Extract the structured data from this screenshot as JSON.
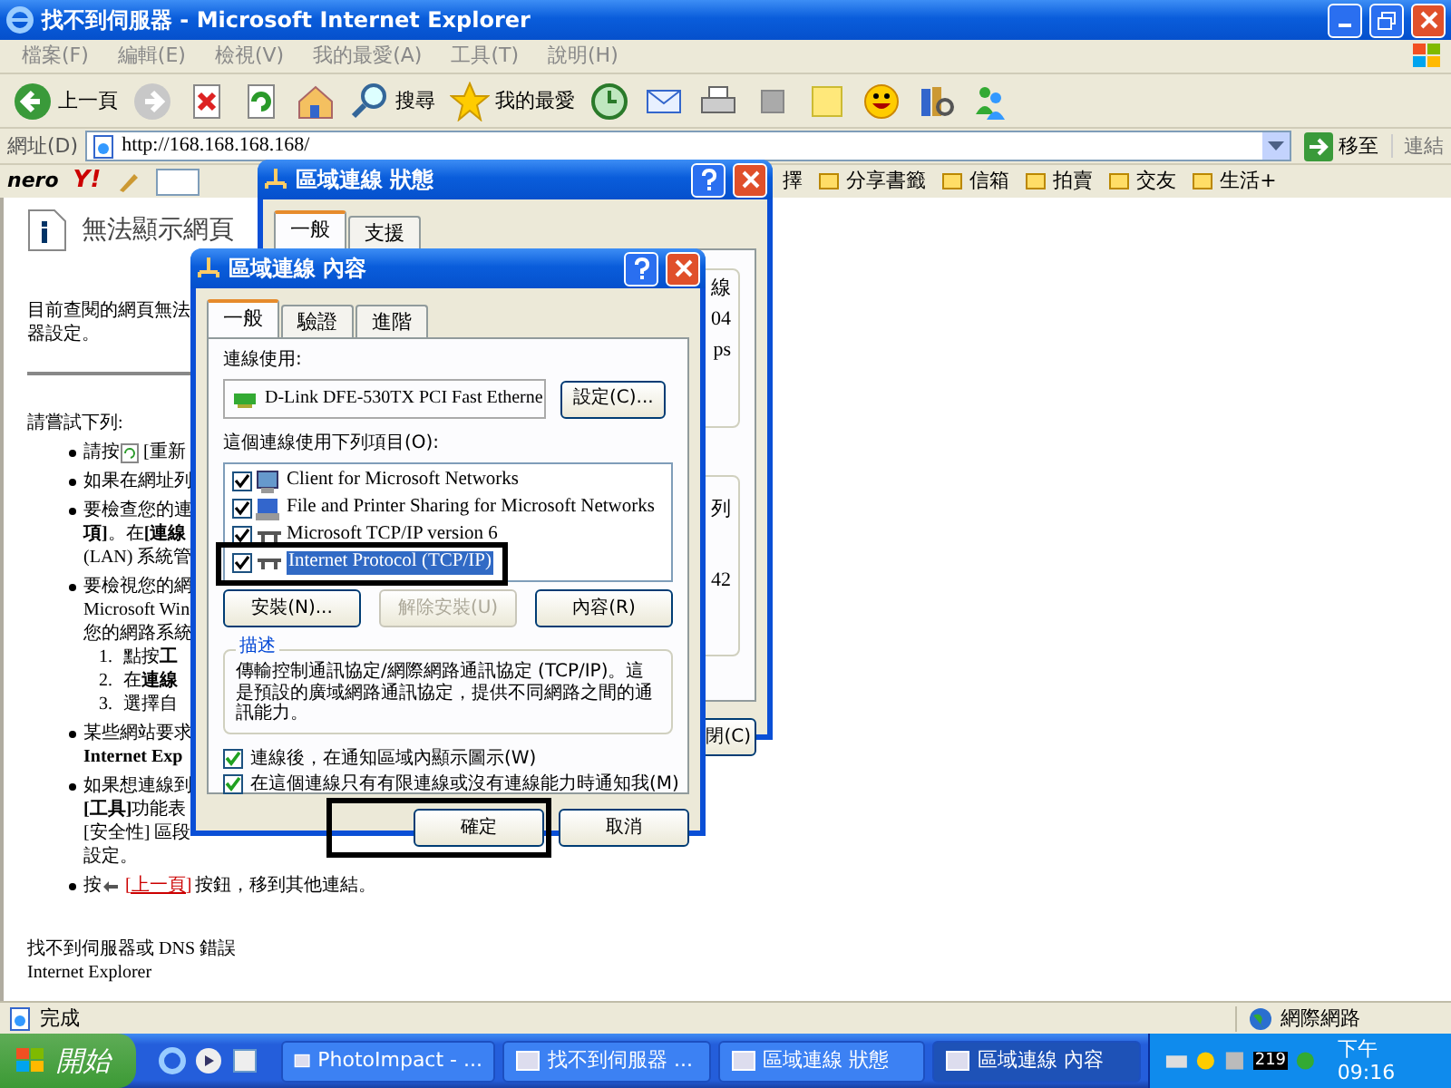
{
  "window": {
    "title": "找不到伺服器 - Microsoft Internet Explorer"
  },
  "menu": [
    "檔案(F)",
    "編輯(E)",
    "檢視(V)",
    "我的最愛(A)",
    "工具(T)",
    "說明(H)"
  ],
  "toolbar": [
    {
      "kind": "back",
      "label": "上一頁"
    },
    {
      "kind": "forward"
    },
    {
      "kind": "stop"
    },
    {
      "kind": "refresh"
    },
    {
      "kind": "home"
    },
    {
      "kind": "search",
      "label": "搜尋"
    },
    {
      "kind": "favorites",
      "label": "我的最愛"
    },
    {
      "kind": "history"
    },
    {
      "kind": "mail"
    },
    {
      "kind": "print"
    },
    {
      "kind": "edit"
    },
    {
      "kind": "note"
    },
    {
      "kind": "smiley"
    },
    {
      "kind": "research"
    },
    {
      "kind": "messenger"
    }
  ],
  "address": {
    "label": "網址(D)",
    "value": "http://168.168.168.168/",
    "go": "移至",
    "links": "連結"
  },
  "links_bar": {
    "left": [
      {
        "kind": "logo",
        "label": "nero"
      },
      {
        "kind": "logo",
        "label": "Y!"
      }
    ],
    "right": [
      {
        "kind": "text",
        "label": "擇"
      },
      {
        "kind": "link",
        "label": "分享書籤"
      },
      {
        "kind": "link",
        "label": "信箱"
      },
      {
        "kind": "link",
        "label": "拍賣"
      },
      {
        "kind": "link",
        "label": "交友"
      },
      {
        "kind": "link",
        "label": "生活+"
      }
    ]
  },
  "page": {
    "heading": "無法顯示網頁",
    "lines": [
      {
        "kind": "para",
        "text": "目前查閱的網頁無法"
      },
      {
        "kind": "para",
        "text": "器設定。"
      },
      {
        "kind": "rule"
      },
      {
        "kind": "para",
        "text": "請嘗試下列:"
      },
      {
        "kind": "bullet",
        "text": "請按",
        "has_icon": true,
        "rest": "[重新"
      },
      {
        "kind": "bullet",
        "text": "如果在網址列"
      },
      {
        "kind": "bullet",
        "text": "要檢查您的連"
      },
      {
        "kind": "cont",
        "text": "**項]**。在**[連線**"
      },
      {
        "kind": "cont",
        "text": "(LAN) 系統管"
      },
      {
        "kind": "bullet",
        "text": "要檢視您的網"
      },
      {
        "kind": "cont",
        "text": "Microsoft Win"
      },
      {
        "kind": "cont",
        "text": "您的網路系統"
      },
      {
        "kind": "num",
        "number": "1.",
        "text": "點按**工**"
      },
      {
        "kind": "num",
        "number": "2.",
        "text": "在**連線**"
      },
      {
        "kind": "num",
        "number": "3.",
        "text": "選擇自"
      },
      {
        "kind": "bullet",
        "text": "某些網站要求"
      },
      {
        "kind": "cont",
        "text": "Internet Exp",
        "bold": true
      },
      {
        "kind": "bullet",
        "text": "如果想連線到"
      },
      {
        "kind": "cont",
        "text": "**[工具]**功能表"
      },
      {
        "kind": "cont",
        "text": "[安全性] 區段"
      },
      {
        "kind": "cont",
        "text": "設定。"
      },
      {
        "kind": "bullet",
        "text": "按",
        "has_icon": true,
        "link": "[上一頁]",
        "rest": "按鈕，移到其他連結。"
      }
    ],
    "footer": [
      "找不到伺服器或 DNS 錯誤",
      "Internet Explorer"
    ]
  },
  "status_dialog": {
    "title": "區域連線 狀態",
    "tabs": [
      {
        "label": "一般",
        "selected": true
      },
      {
        "label": "支援",
        "selected": false
      }
    ],
    "group_1": [
      "線",
      "04",
      "ps"
    ],
    "group_2": [
      "列",
      "42"
    ],
    "button": "閉(C)"
  },
  "properties_dialog": {
    "title": "區域連線 內容",
    "tabs": [
      {
        "label": "一般",
        "selected": true
      },
      {
        "label": "驗證",
        "selected": false
      },
      {
        "label": "進階",
        "selected": false
      }
    ],
    "connect_using_label": "連線使用:",
    "adapter": "D-Link DFE-530TX PCI Fast Etherne",
    "configure_button": "設定(C)...",
    "items_label": "這個連線使用下列項目(O):",
    "items": [
      {
        "kind": "client",
        "label": "Client for Microsoft Networks",
        "checked": true,
        "selected": false
      },
      {
        "kind": "service",
        "label": "File and Printer Sharing for Microsoft Networks",
        "checked": true,
        "selected": false
      },
      {
        "kind": "protocol",
        "label": "Microsoft TCP/IP version 6",
        "checked": true,
        "selected": false
      },
      {
        "kind": "protocol",
        "label": "Internet Protocol (TCP/IP)",
        "checked": true,
        "selected": true
      }
    ],
    "buttons": [
      {
        "label": "安裝(N)...",
        "disabled": false
      },
      {
        "label": "解除安裝(U)",
        "disabled": true
      },
      {
        "label": "內容(R)",
        "disabled": false
      }
    ],
    "description": {
      "title": "描述",
      "text": "傳輸控制通訊協定/網際網路通訊協定 (TCP/IP)。這是預設的廣域網路通訊協定，提供不同網路之間的通訊能力。"
    },
    "options": [
      {
        "label": "連線後，在通知區域內顯示圖示(W)",
        "checked": true
      },
      {
        "label": "在這個連線只有有限連線或沒有連線能力時通知我(M)",
        "checked": true
      }
    ],
    "ok": "確定",
    "cancel": "取消"
  },
  "status_bar": {
    "text": "完成",
    "zone": "網際網路"
  },
  "taskbar": {
    "start": "開始",
    "tasks": [
      {
        "label": "PhotoImpact - ...",
        "selected": false
      },
      {
        "label": "找不到伺服器 ...",
        "selected": false
      },
      {
        "label": "區域連線 狀態",
        "selected": false
      },
      {
        "label": "區域連線 內容",
        "selected": true
      }
    ],
    "badge": "219",
    "clock": "下午 09:16"
  }
}
